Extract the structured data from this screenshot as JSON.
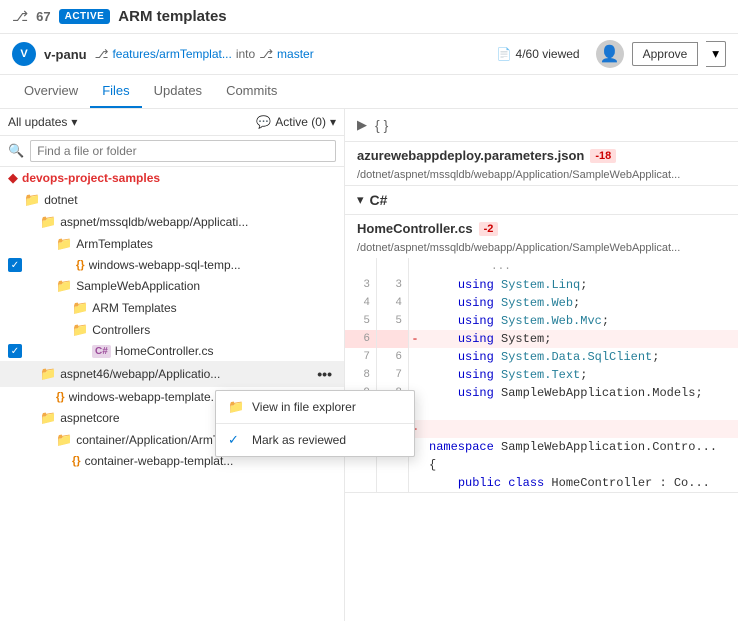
{
  "topBar": {
    "prNumber": "67",
    "activeBadge": "ACTIVE",
    "prTitle": "ARM templates",
    "userName": "v-panu",
    "userInitials": "V",
    "sourceBranch": "features/armTemplat...",
    "intoText": "into",
    "targetBranch": "master",
    "viewedCount": "4/60 viewed",
    "approveLabel": "Approve"
  },
  "navTabs": {
    "overview": "Overview",
    "files": "Files",
    "updates": "Updates",
    "commits": "Commits"
  },
  "filterBar": {
    "allUpdates": "All updates",
    "activeFilter": "Active (0)"
  },
  "searchBox": {
    "placeholder": "Find a file or folder"
  },
  "fileTree": [
    {
      "id": "root",
      "label": "devops-project-samples",
      "type": "root",
      "indent": 0,
      "checked": false
    },
    {
      "id": "dotnet",
      "label": "dotnet",
      "type": "folder",
      "indent": 1,
      "checked": false
    },
    {
      "id": "aspnet-webapp",
      "label": "aspnet/mssqldb/webapp/Applicati...",
      "type": "folder",
      "indent": 2,
      "checked": false
    },
    {
      "id": "armtemplates",
      "label": "ArmTemplates",
      "type": "folder",
      "indent": 3,
      "checked": false
    },
    {
      "id": "windows-webapp-sql",
      "label": "windows-webapp-sql-temp...",
      "type": "json",
      "indent": 4,
      "checked": true
    },
    {
      "id": "samplewebapp",
      "label": "SampleWebApplication",
      "type": "folder",
      "indent": 3,
      "checked": false
    },
    {
      "id": "arm-templates2",
      "label": "ARM Templates",
      "type": "folder",
      "indent": 4,
      "checked": false
    },
    {
      "id": "controllers",
      "label": "Controllers",
      "type": "folder",
      "indent": 4,
      "checked": false
    },
    {
      "id": "homecontroller",
      "label": "HomeController.cs",
      "type": "cs",
      "indent": 5,
      "checked": true
    },
    {
      "id": "aspnet46-webapp",
      "label": "aspnet46/webapp/Applicatio...",
      "type": "folder",
      "indent": 2,
      "checked": false,
      "hasEllipsis": true
    },
    {
      "id": "windows-webapp-template",
      "label": "windows-webapp-template...",
      "type": "json",
      "indent": 3,
      "checked": false
    },
    {
      "id": "aspnetcore",
      "label": "aspnetcore",
      "type": "folder",
      "indent": 2,
      "checked": false
    },
    {
      "id": "container-armT",
      "label": "container/Application/ArmTe...",
      "type": "folder",
      "indent": 3,
      "checked": false
    },
    {
      "id": "container-webapp-templ",
      "label": "container-webapp-templat...",
      "type": "json",
      "indent": 4,
      "checked": false
    }
  ],
  "contextMenu": {
    "viewInExplorer": "View in file explorer",
    "markAsReviewed": "Mark as reviewed"
  },
  "rightPanel": {
    "collapsedFile": {
      "braceIcon": "{ }",
      "fileName": "azurewebappdeploy.parameters.json",
      "changeBadge": "-18",
      "filePath": "/dotnet/aspnet/mssqldb/webapp/Application/SampleWebApplicat..."
    },
    "csSection": {
      "chevron": "▾",
      "langLabel": "C#",
      "fileName": "HomeController.cs",
      "changeBadge": "-2",
      "filePath": "/dotnet/aspnet/mssqldb/webapp/Application/SampleWebApplicat..."
    },
    "codeLines": [
      {
        "ln1": "",
        "ln2": "",
        "content": "...",
        "type": "ellipsis"
      },
      {
        "ln1": "3",
        "ln2": "3",
        "content": "    using System.Linq;",
        "type": "normal"
      },
      {
        "ln1": "4",
        "ln2": "4",
        "content": "    using System.Web;",
        "type": "normal"
      },
      {
        "ln1": "5",
        "ln2": "5",
        "content": "    using System.Web.Mvc;",
        "type": "normal"
      },
      {
        "ln1": "6",
        "ln2": "",
        "content": "-   using System;",
        "type": "deleted"
      },
      {
        "ln1": "7",
        "ln2": "6",
        "content": "    using System.Data.SqlClient;",
        "type": "normal"
      },
      {
        "ln1": "8",
        "ln2": "7",
        "content": "    using System.Text;",
        "type": "normal"
      },
      {
        "ln1": "9",
        "ln2": "8",
        "content": "    using SampleWebApplication.Models;",
        "type": "normal"
      },
      {
        "ln1": "10",
        "ln2": "9",
        "content": "",
        "type": "normal"
      },
      {
        "ln1": "11",
        "ln2": "",
        "content": "-",
        "type": "deleted2"
      },
      {
        "ln1": "",
        "ln2": "",
        "content": "namespace SampleWebApplication.Contro...",
        "type": "namespace"
      },
      {
        "ln1": "",
        "ln2": "",
        "content": "{",
        "type": "brace"
      },
      {
        "ln1": "",
        "ln2": "",
        "content": "    public class HomeController : Co...",
        "type": "class"
      }
    ]
  }
}
